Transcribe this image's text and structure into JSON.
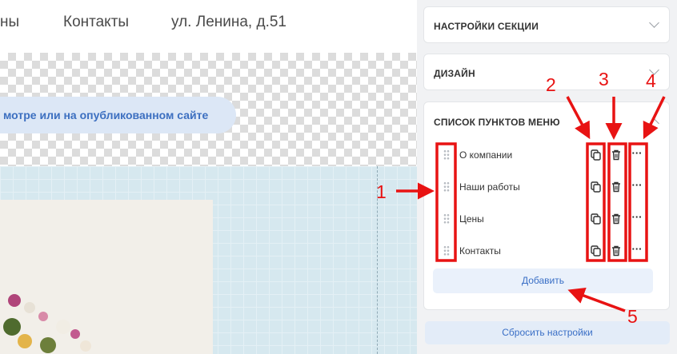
{
  "canvas": {
    "nav_items": [
      "ны",
      "Контакты",
      "ул. Ленина, д.51"
    ],
    "hint_text": "мотре или на опубликованном сайте"
  },
  "sidebar": {
    "sections": {
      "settings": {
        "title": "НАСТРОЙКИ СЕКЦИИ",
        "expanded": false
      },
      "design": {
        "title": "ДИЗАЙН",
        "expanded": false
      },
      "menu_list": {
        "title": "СПИСОК ПУНКТОВ МЕНЮ",
        "expanded": true
      }
    },
    "menu_items": [
      {
        "label": "О компании"
      },
      {
        "label": "Наши работы"
      },
      {
        "label": "Цены"
      },
      {
        "label": "Контакты"
      }
    ],
    "add_label": "Добавить",
    "reset_label": "Сбросить настройки"
  },
  "annotations": {
    "color": "#e81313",
    "labels": [
      "1",
      "2",
      "3",
      "4",
      "5"
    ]
  },
  "colors": {
    "accent_text": "#3a6fc6",
    "button_bg": "#eaf1fb",
    "grid_bg": "#d6e8ef"
  }
}
